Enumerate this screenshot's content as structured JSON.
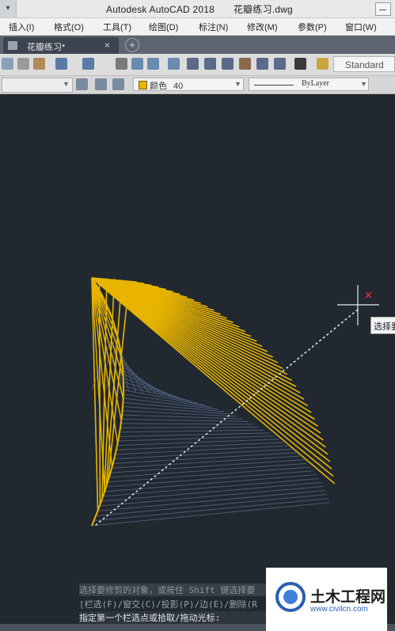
{
  "window": {
    "app_title": "Autodesk AutoCAD 2018",
    "file_title": "花瓣练习.dwg"
  },
  "menu": {
    "items": [
      "插入(I)",
      "格式(O)",
      "工具(T)",
      "绘图(D)",
      "标注(N)",
      "修改(M)",
      "参数(P)",
      "窗口(W)"
    ]
  },
  "tabs": {
    "active_label": "花瓣练习*",
    "close_glyph": "×",
    "new_glyph": "+"
  },
  "toolbar": {
    "text_style": "Standard"
  },
  "properties": {
    "color_label": "颜色",
    "color_value": "40",
    "color_hex": "#e8b400",
    "linetype_label": "ByLayer"
  },
  "canvas": {
    "background": "#212830",
    "line_color": "#e8b400",
    "shadow_color": "#4b5a78",
    "tooltip_text": "选择要"
  },
  "command_line": {
    "line1": "选择要修剪的对象，或按住 Shift 键选择要",
    "line2": "[栏选(F)/窗交(C)/投影(P)/边(E)/删除(R",
    "line3": "指定第一个栏选点或拾取/拖动光标:"
  },
  "watermark": {
    "title": "土木工程网",
    "url": "www.civilcn.com"
  }
}
